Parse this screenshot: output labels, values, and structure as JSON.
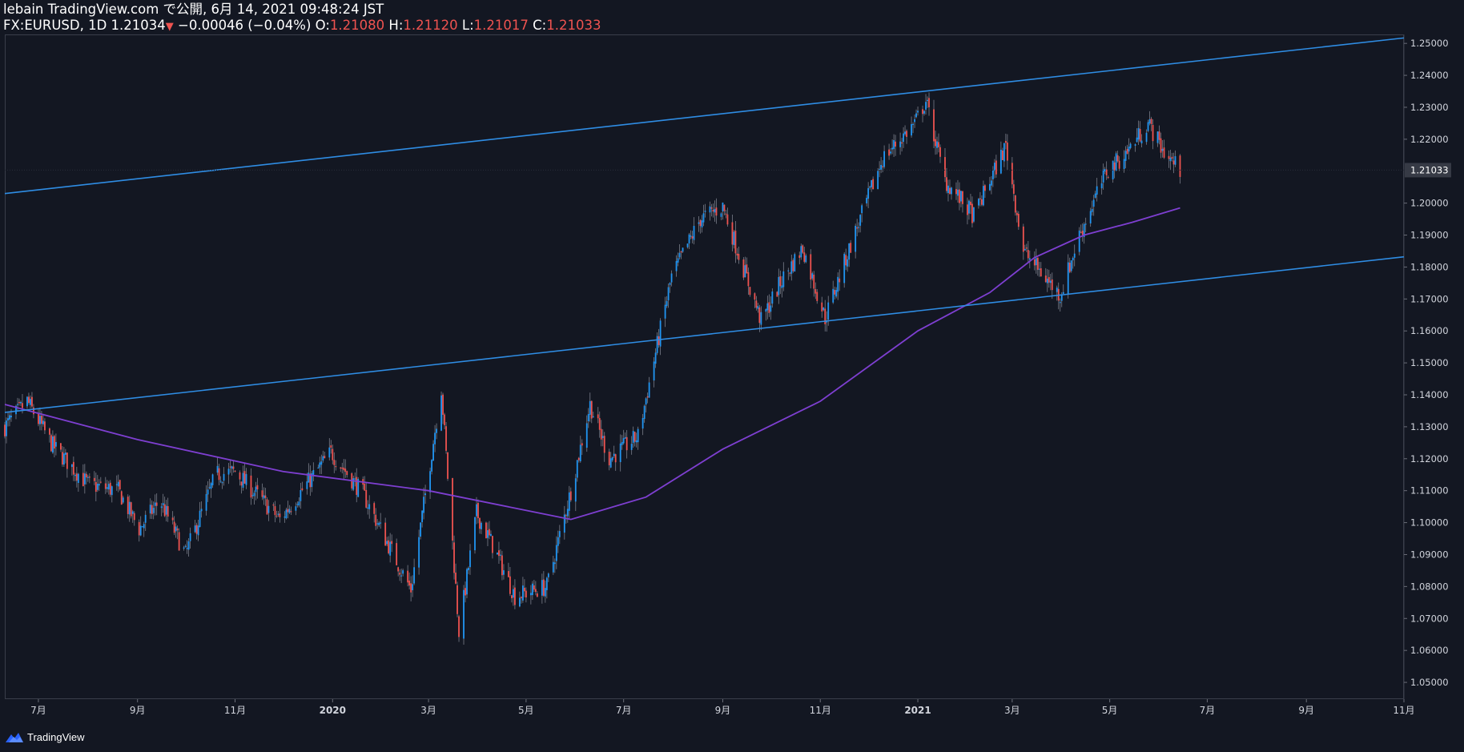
{
  "header": {
    "line1": "lebain TradingView.com で公開, 6月 14, 2021 09:48:24 JST",
    "symbol_prefix": "FX:EURUSD, 1D 1.21034",
    "down_arrow": "▼",
    "change": "−0.00046 (−0.04%)",
    "o_label": "O:",
    "o_value": "1.21080",
    "h_label": "H:",
    "h_value": "1.21120",
    "l_label": "L:",
    "l_value": "1.21017",
    "c_label": "C:",
    "c_value": "1.21033"
  },
  "footer": {
    "brand": "TradingView"
  },
  "colors": {
    "background": "#131722",
    "up": "#2196f3",
    "down": "#ef5350",
    "trendline": "#2f8de4",
    "moving_average": "#7e3fd1",
    "axis_text": "#d1d4dc"
  },
  "chart_data": {
    "type": "candlestick",
    "symbol": "FX:EURUSD",
    "interval": "1D",
    "last_price": "1.21033",
    "ylim": [
      1.045,
      1.2528
    ],
    "yticks": [
      "1.25000",
      "1.24000",
      "1.23000",
      "1.22000",
      "1.20000",
      "1.19000",
      "1.18000",
      "1.17000",
      "1.16000",
      "1.15000",
      "1.14000",
      "1.13000",
      "1.12000",
      "1.11000",
      "1.10000",
      "1.09000",
      "1.08000",
      "1.07000",
      "1.06000",
      "1.05000"
    ],
    "xticks": [
      "7月",
      "9月",
      "11月",
      "2020",
      "3月",
      "5月",
      "7月",
      "9月",
      "11月",
      "2021",
      "3月",
      "5月",
      "7月",
      "9月",
      "11月"
    ],
    "x_start": "2019-06-10",
    "x_end": "2021-11-01",
    "price_path": [
      [
        "2019-06-10",
        1.13
      ],
      [
        "2019-06-24",
        1.138
      ],
      [
        "2019-07-10",
        1.124
      ],
      [
        "2019-08-01",
        1.112
      ],
      [
        "2019-08-20",
        1.11
      ],
      [
        "2019-09-02",
        1.098
      ],
      [
        "2019-09-15",
        1.107
      ],
      [
        "2019-10-01",
        1.09
      ],
      [
        "2019-10-20",
        1.115
      ],
      [
        "2019-11-01",
        1.116
      ],
      [
        "2019-11-29",
        1.101
      ],
      [
        "2019-12-31",
        1.122
      ],
      [
        "2020-01-20",
        1.109
      ],
      [
        "2020-02-19",
        1.079
      ],
      [
        "2020-03-09",
        1.142
      ],
      [
        "2020-03-20",
        1.066
      ],
      [
        "2020-03-31",
        1.103
      ],
      [
        "2020-04-10",
        1.093
      ],
      [
        "2020-04-24",
        1.077
      ],
      [
        "2020-05-14",
        1.08
      ],
      [
        "2020-05-29",
        1.11
      ],
      [
        "2020-06-10",
        1.137
      ],
      [
        "2020-06-22",
        1.12
      ],
      [
        "2020-07-10",
        1.127
      ],
      [
        "2020-07-31",
        1.177
      ],
      [
        "2020-08-18",
        1.195
      ],
      [
        "2020-09-01",
        1.199
      ],
      [
        "2020-09-25",
        1.163
      ],
      [
        "2020-10-08",
        1.176
      ],
      [
        "2020-10-21",
        1.186
      ],
      [
        "2020-11-04",
        1.164
      ],
      [
        "2020-11-20",
        1.187
      ],
      [
        "2020-12-10",
        1.214
      ],
      [
        "2020-12-30",
        1.225
      ],
      [
        "2021-01-06",
        1.232
      ],
      [
        "2021-01-18",
        1.207
      ],
      [
        "2021-02-05",
        1.196
      ],
      [
        "2021-02-25",
        1.218
      ],
      [
        "2021-03-08",
        1.185
      ],
      [
        "2021-03-31",
        1.171
      ],
      [
        "2021-04-12",
        1.19
      ],
      [
        "2021-04-29",
        1.21
      ],
      [
        "2021-05-10",
        1.215
      ],
      [
        "2021-05-25",
        1.225
      ],
      [
        "2021-06-04",
        1.216
      ],
      [
        "2021-06-14",
        1.2103
      ]
    ],
    "moving_average": [
      [
        "2019-06-10",
        1.137
      ],
      [
        "2019-09-01",
        1.126
      ],
      [
        "2019-12-01",
        1.116
      ],
      [
        "2020-03-01",
        1.11
      ],
      [
        "2020-05-29",
        1.101
      ],
      [
        "2020-07-15",
        1.108
      ],
      [
        "2020-09-01",
        1.123
      ],
      [
        "2020-11-01",
        1.138
      ],
      [
        "2021-01-01",
        1.16
      ],
      [
        "2021-02-15",
        1.172
      ],
      [
        "2021-03-15",
        1.183
      ],
      [
        "2021-04-15",
        1.19
      ],
      [
        "2021-05-15",
        1.194
      ],
      [
        "2021-06-14",
        1.1985
      ]
    ],
    "trendlines": [
      {
        "start": [
          "2019-06-10",
          1.203
        ],
        "end": [
          "2021-11-01",
          1.2517
        ]
      },
      {
        "start": [
          "2019-06-10",
          1.1345
        ],
        "end": [
          "2021-11-01",
          1.1832
        ]
      }
    ]
  }
}
